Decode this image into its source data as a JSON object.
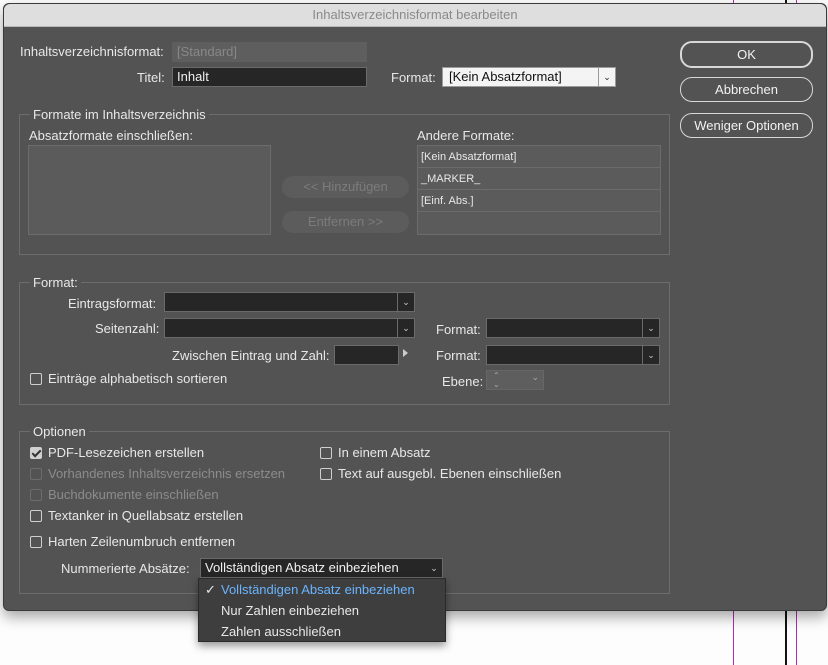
{
  "window": {
    "title": "Inhaltsverzeichnisformat bearbeiten"
  },
  "top": {
    "format_label": "Inhaltsverzeichnisformat:",
    "format_value": "[Standard]",
    "title_label": "Titel:",
    "title_value": "Inhalt",
    "style_label": "Format:",
    "style_value": "[Kein Absatzformat]"
  },
  "buttons": {
    "ok": "OK",
    "cancel": "Abbrechen",
    "fewer": "Weniger Optionen"
  },
  "styles_section": {
    "title": "Formate im Inhaltsverzeichnis",
    "include_label": "Absatzformate einschließen:",
    "add_label": "<< Hinzufügen",
    "remove_label": "Entfernen >>",
    "other_label": "Andere Formate:",
    "other_items": [
      "[Kein Absatzformat]",
      "_MARKER_",
      "[Einf. Abs.]"
    ]
  },
  "format_section": {
    "title": "Format:",
    "entry_label": "Eintragsformat:",
    "entry_value": "",
    "page_label": "Seitenzahl:",
    "page_value": "",
    "page_format_label": "Format:",
    "page_format_value": "",
    "between_label": "Zwischen Eintrag und Zahl:",
    "between_value": "",
    "between_format_label": "Format:",
    "between_format_value": "",
    "sort_label": "Einträge alphabetisch sortieren",
    "sort_checked": false,
    "level_label": "Ebene:",
    "level_value": ""
  },
  "options_section": {
    "title": "Optionen",
    "pdf_label": "PDF-Lesezeichen erstellen",
    "pdf_checked": true,
    "replace_label": "Vorhandenes Inhaltsverzeichnis ersetzen",
    "book_label": "Buchdokumente einschließen",
    "anchor_label": "Textanker in Quellabsatz erstellen",
    "break_label": "Harten Zeilenumbruch entfernen",
    "runin_label": "In einem Absatz",
    "hidden_label": "Text auf ausgebl. Ebenen einschließen",
    "numbered_label": "Nummerierte Absätze:",
    "numbered_value": "Vollständigen Absatz einbeziehen"
  },
  "dropdown_menu": {
    "items": [
      "Vollständigen Absatz einbeziehen",
      "Nur Zahlen einbeziehen",
      "Zahlen ausschließen"
    ],
    "selected_index": 0
  },
  "colors": {
    "dialog_bg": "#535353",
    "accent": "#6ab4ff",
    "background_line": "#c020c0"
  }
}
